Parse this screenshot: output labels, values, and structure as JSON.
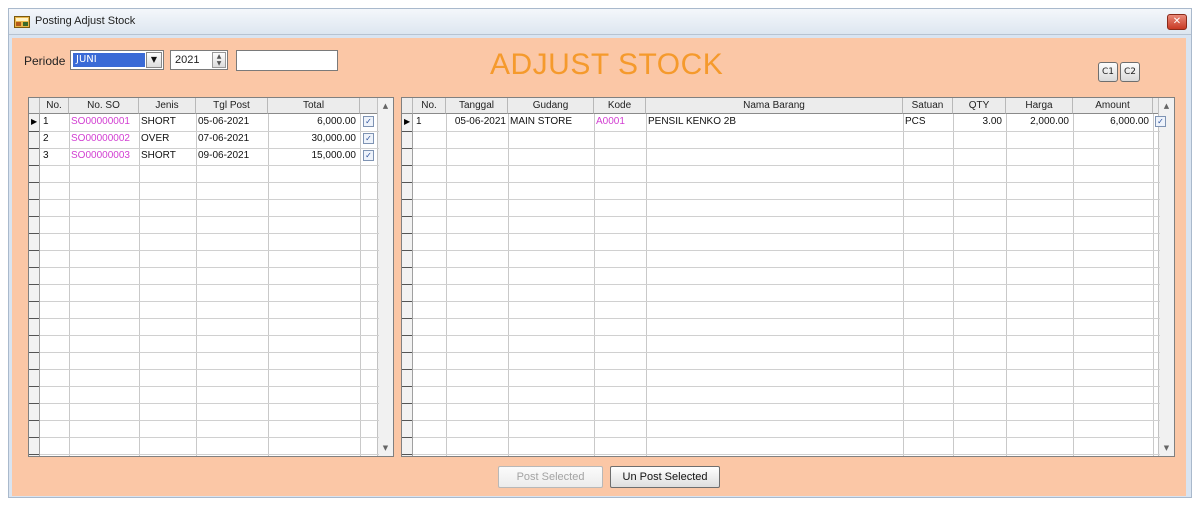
{
  "window": {
    "title": "Posting Adjust Stock",
    "close_glyph": "✕"
  },
  "filter": {
    "periode_label": "Periode",
    "month_value": "JUNI",
    "year_value": "2021",
    "extra_value": ""
  },
  "heading": "ADJUST STOCK",
  "mini_buttons": [
    "C1",
    "C2"
  ],
  "left_grid": {
    "columns": [
      "No.",
      "No. SO",
      "Jenis",
      "Tgl Post",
      "Total"
    ],
    "rows": [
      {
        "no": "1",
        "no_so": "SO00000001",
        "jenis": "SHORT",
        "tgl_post": "05-06-2021",
        "total": "6,000.00",
        "checked": true,
        "current": true
      },
      {
        "no": "2",
        "no_so": "SO00000002",
        "jenis": "OVER",
        "tgl_post": "07-06-2021",
        "total": "30,000.00",
        "checked": true,
        "current": false
      },
      {
        "no": "3",
        "no_so": "SO00000003",
        "jenis": "SHORT",
        "tgl_post": "09-06-2021",
        "total": "15,000.00",
        "checked": true,
        "current": false
      }
    ]
  },
  "right_grid": {
    "columns": [
      "No.",
      "Tanggal",
      "Gudang",
      "Kode",
      "Nama Barang",
      "Satuan",
      "QTY",
      "Harga",
      "Amount"
    ],
    "rows": [
      {
        "no": "1",
        "tanggal": "05-06-2021",
        "gudang": "MAIN STORE",
        "kode": "A0001",
        "nama_barang": "PENSIL KENKO 2B",
        "satuan": "PCS",
        "qty": "3.00",
        "harga": "2,000.00",
        "amount": "6,000.00",
        "checked": true,
        "current": true
      }
    ]
  },
  "buttons": {
    "post_selected": "Post Selected",
    "unpost_selected": "Un Post Selected"
  },
  "colors": {
    "client_bg": "#fbc7a6",
    "heading": "#f59a2c",
    "accent_link": "#d23fd2"
  }
}
